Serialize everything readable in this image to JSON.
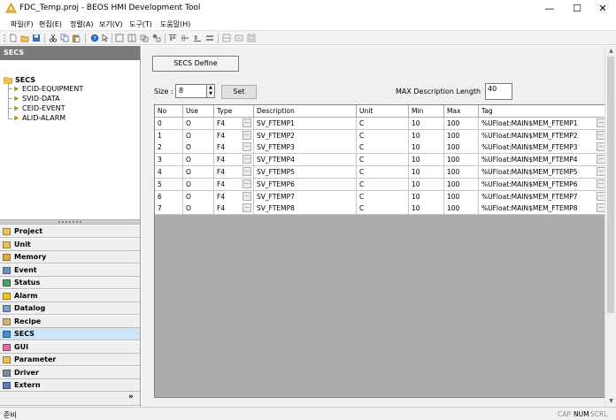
{
  "window": {
    "title": "FDC_Temp.proj - BEOS HMI Development Tool",
    "minimize": "—",
    "maximize": "☐",
    "close": "✕"
  },
  "menu": [
    "파일(F)",
    "편집(E)",
    "정렬(A)",
    "보기(V)",
    "도구(T)",
    "도움말(H)"
  ],
  "left_panel": {
    "header": "SECS",
    "tree": {
      "root": "SECS",
      "children": [
        "ECID-EQUIPMENT",
        "SVID-DATA",
        "CEID-EVENT",
        "ALID-ALARM"
      ]
    },
    "nav": [
      {
        "label": "Project",
        "icon": "folder-icon",
        "color": "#e8c35a"
      },
      {
        "label": "Unit",
        "icon": "folder-icon",
        "color": "#e8c35a"
      },
      {
        "label": "Memory",
        "icon": "memory-icon",
        "color": "#e3a93e"
      },
      {
        "label": "Event",
        "icon": "event-icon",
        "color": "#6f8fc4"
      },
      {
        "label": "Status",
        "icon": "status-icon",
        "color": "#49a36a"
      },
      {
        "label": "Alarm",
        "icon": "alarm-icon",
        "color": "#f0c51f"
      },
      {
        "label": "Datalog",
        "icon": "datalog-icon",
        "color": "#7a9cc6"
      },
      {
        "label": "Recipe",
        "icon": "recipe-icon",
        "color": "#d3b27a"
      },
      {
        "label": "SECS",
        "icon": "secs-icon",
        "color": "#3f8ed6"
      },
      {
        "label": "GUI",
        "icon": "gui-icon",
        "color": "#d86fa3"
      },
      {
        "label": "Parameter",
        "icon": "parameter-icon",
        "color": "#e8c35a"
      },
      {
        "label": "Driver",
        "icon": "driver-icon",
        "color": "#7d8c9c"
      },
      {
        "label": "Extern",
        "icon": "extern-icon",
        "color": "#5a7fb5"
      }
    ],
    "active_nav": "SECS",
    "more": "»"
  },
  "main": {
    "define_button": "SECS Define",
    "size_label": "Size :",
    "size_value": "8",
    "set_button": "Set",
    "max_desc_label": "MAX Description Length",
    "max_desc_value": "40",
    "columns": [
      "No",
      "Use",
      "Type",
      "Description",
      "Unit",
      "Min",
      "Max",
      "Tag"
    ],
    "rows": [
      [
        "0",
        "O",
        "F4",
        "SV_FTEMP1",
        "C",
        "10",
        "100",
        "%UFloat:MAIN$MEM_FTEMP1"
      ],
      [
        "1",
        "O",
        "F4",
        "SV_FTEMP2",
        "C",
        "10",
        "100",
        "%UFloat:MAIN$MEM_FTEMP2"
      ],
      [
        "2",
        "O",
        "F4",
        "SV_FTEMP3",
        "C",
        "10",
        "100",
        "%UFloat:MAIN$MEM_FTEMP3"
      ],
      [
        "3",
        "O",
        "F4",
        "SV_FTEMP4",
        "C",
        "10",
        "100",
        "%UFloat:MAIN$MEM_FTEMP4"
      ],
      [
        "4",
        "O",
        "F4",
        "SV_FTEMP5",
        "C",
        "10",
        "100",
        "%UFloat:MAIN$MEM_FTEMP5"
      ],
      [
        "5",
        "O",
        "F4",
        "SV_FTEMP6",
        "C",
        "10",
        "100",
        "%UFloat:MAIN$MEM_FTEMP6"
      ],
      [
        "6",
        "O",
        "F4",
        "SV_FTEMP7",
        "C",
        "10",
        "100",
        "%UFloat:MAIN$MEM_FTEMP7"
      ],
      [
        "7",
        "O",
        "F4",
        "SV_FTEMP8",
        "C",
        "10",
        "100",
        "%UFloat:MAIN$MEM_FTEMP8"
      ]
    ],
    "dots": "..."
  },
  "status": {
    "left": "준비",
    "indicators": [
      {
        "label": "CAP",
        "on": false
      },
      {
        "label": "NUM",
        "on": true
      },
      {
        "label": "SCRL",
        "on": false
      }
    ]
  }
}
